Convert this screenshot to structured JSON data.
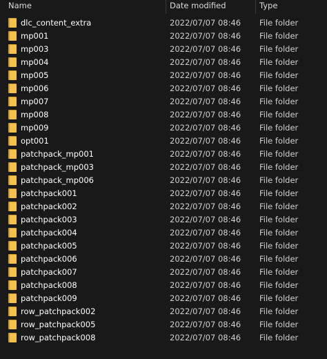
{
  "columns": {
    "name": "Name",
    "date": "Date modified",
    "type": "Type"
  },
  "colors": {
    "background": "#191919",
    "folder": "#f2c14e",
    "text": "#ffffff"
  },
  "rows": [
    {
      "name": "dlc_content_extra",
      "date": "2022/07/07 08:46",
      "type": "File folder",
      "icon": "folder-icon"
    },
    {
      "name": "mp001",
      "date": "2022/07/07 08:46",
      "type": "File folder",
      "icon": "folder-icon"
    },
    {
      "name": "mp003",
      "date": "2022/07/07 08:46",
      "type": "File folder",
      "icon": "folder-icon"
    },
    {
      "name": "mp004",
      "date": "2022/07/07 08:46",
      "type": "File folder",
      "icon": "folder-icon"
    },
    {
      "name": "mp005",
      "date": "2022/07/07 08:46",
      "type": "File folder",
      "icon": "folder-icon"
    },
    {
      "name": "mp006",
      "date": "2022/07/07 08:46",
      "type": "File folder",
      "icon": "folder-icon"
    },
    {
      "name": "mp007",
      "date": "2022/07/07 08:46",
      "type": "File folder",
      "icon": "folder-icon"
    },
    {
      "name": "mp008",
      "date": "2022/07/07 08:46",
      "type": "File folder",
      "icon": "folder-icon"
    },
    {
      "name": "mp009",
      "date": "2022/07/07 08:46",
      "type": "File folder",
      "icon": "folder-icon"
    },
    {
      "name": "opt001",
      "date": "2022/07/07 08:46",
      "type": "File folder",
      "icon": "folder-icon"
    },
    {
      "name": "patchpack_mp001",
      "date": "2022/07/07 08:46",
      "type": "File folder",
      "icon": "folder-icon"
    },
    {
      "name": "patchpack_mp003",
      "date": "2022/07/07 08:46",
      "type": "File folder",
      "icon": "folder-icon"
    },
    {
      "name": "patchpack_mp006",
      "date": "2022/07/07 08:46",
      "type": "File folder",
      "icon": "folder-icon"
    },
    {
      "name": "patchpack001",
      "date": "2022/07/07 08:46",
      "type": "File folder",
      "icon": "folder-icon"
    },
    {
      "name": "patchpack002",
      "date": "2022/07/07 08:46",
      "type": "File folder",
      "icon": "folder-icon"
    },
    {
      "name": "patchpack003",
      "date": "2022/07/07 08:46",
      "type": "File folder",
      "icon": "folder-icon"
    },
    {
      "name": "patchpack004",
      "date": "2022/07/07 08:46",
      "type": "File folder",
      "icon": "folder-icon"
    },
    {
      "name": "patchpack005",
      "date": "2022/07/07 08:46",
      "type": "File folder",
      "icon": "folder-icon"
    },
    {
      "name": "patchpack006",
      "date": "2022/07/07 08:46",
      "type": "File folder",
      "icon": "folder-icon"
    },
    {
      "name": "patchpack007",
      "date": "2022/07/07 08:46",
      "type": "File folder",
      "icon": "folder-icon"
    },
    {
      "name": "patchpack008",
      "date": "2022/07/07 08:46",
      "type": "File folder",
      "icon": "folder-icon"
    },
    {
      "name": "patchpack009",
      "date": "2022/07/07 08:46",
      "type": "File folder",
      "icon": "folder-icon"
    },
    {
      "name": "row_patchpack002",
      "date": "2022/07/07 08:46",
      "type": "File folder",
      "icon": "folder-icon"
    },
    {
      "name": "row_patchpack005",
      "date": "2022/07/07 08:46",
      "type": "File folder",
      "icon": "folder-icon"
    },
    {
      "name": "row_patchpack008",
      "date": "2022/07/07 08:46",
      "type": "File folder",
      "icon": "folder-icon"
    }
  ]
}
